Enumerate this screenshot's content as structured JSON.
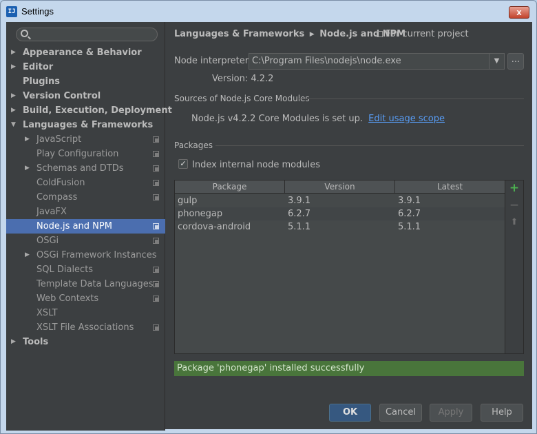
{
  "window": {
    "title": "Settings",
    "icon": "intellij-icon",
    "close_label": "x"
  },
  "search": {
    "placeholder": ""
  },
  "sidebar": {
    "items": [
      {
        "label": "Appearance & Behavior",
        "level": 0,
        "arrow": "▶",
        "project": false
      },
      {
        "label": "Editor",
        "level": 0,
        "arrow": "▶",
        "project": false
      },
      {
        "label": "Plugins",
        "level": 0,
        "arrow": "",
        "project": false
      },
      {
        "label": "Version Control",
        "level": 0,
        "arrow": "▶",
        "project": false
      },
      {
        "label": "Build, Execution, Deployment",
        "level": 0,
        "arrow": "▶",
        "project": false
      },
      {
        "label": "Languages & Frameworks",
        "level": 0,
        "arrow": "▼",
        "project": false
      },
      {
        "label": "JavaScript",
        "level": 1,
        "arrow": "▶",
        "project": true
      },
      {
        "label": "Play Configuration",
        "level": 1,
        "arrow": "",
        "project": true
      },
      {
        "label": "Schemas and DTDs",
        "level": 1,
        "arrow": "▶",
        "project": true
      },
      {
        "label": "ColdFusion",
        "level": 1,
        "arrow": "",
        "project": true
      },
      {
        "label": "Compass",
        "level": 1,
        "arrow": "",
        "project": true
      },
      {
        "label": "JavaFX",
        "level": 1,
        "arrow": "",
        "project": false
      },
      {
        "label": "Node.js and NPM",
        "level": 1,
        "arrow": "",
        "project": true,
        "selected": true
      },
      {
        "label": "OSGi",
        "level": 1,
        "arrow": "",
        "project": true
      },
      {
        "label": "OSGi Framework Instances",
        "level": 1,
        "arrow": "▶",
        "project": false
      },
      {
        "label": "SQL Dialects",
        "level": 1,
        "arrow": "",
        "project": true
      },
      {
        "label": "Template Data Languages",
        "level": 1,
        "arrow": "",
        "project": true
      },
      {
        "label": "Web Contexts",
        "level": 1,
        "arrow": "",
        "project": true
      },
      {
        "label": "XSLT",
        "level": 1,
        "arrow": "",
        "project": false
      },
      {
        "label": "XSLT File Associations",
        "level": 1,
        "arrow": "",
        "project": true
      },
      {
        "label": "Tools",
        "level": 0,
        "arrow": "▶",
        "project": false
      }
    ]
  },
  "header": {
    "breadcrumb_parent": "Languages & Frameworks",
    "breadcrumb_sep": "▶",
    "breadcrumb_current": "Node.js and NPM",
    "scope_label": "For current project"
  },
  "interpreter": {
    "label": "Node interpreter:",
    "value": "C:\\Program Files\\nodejs\\node.exe",
    "drop_arrow": "▼",
    "browse_label": "...",
    "version_label": "Version: 4.2.2"
  },
  "core_modules": {
    "section_title": "Sources of Node.js Core Modules",
    "status_text": "Node.js v4.2.2 Core Modules is set up.",
    "link_text": "Edit usage scope"
  },
  "packages": {
    "section_title": "Packages",
    "checkbox_label": "Index internal node modules",
    "checkbox_checked": true,
    "checkmark": "✓",
    "columns": [
      "Package",
      "Version",
      "Latest"
    ],
    "rows": [
      [
        "gulp",
        "3.9.1",
        "3.9.1"
      ],
      [
        "phonegap",
        "6.2.7",
        "6.2.7"
      ],
      [
        "cordova-android",
        "5.1.1",
        "5.1.1"
      ]
    ],
    "tools": {
      "add": "+",
      "remove": "−",
      "upgrade": "⬆"
    }
  },
  "status_message": "Package 'phonegap' installed successfully",
  "footer": {
    "ok": "OK",
    "cancel": "Cancel",
    "apply": "Apply",
    "help": "Help"
  },
  "colors": {
    "selection": "#4b6eaf",
    "status_bg": "#49753b",
    "link": "#589df6",
    "add_icon": "#4caf50"
  }
}
